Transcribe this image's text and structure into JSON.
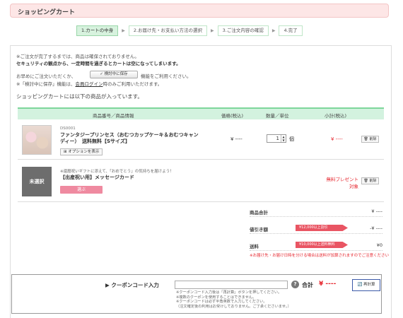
{
  "header": {
    "title": "ショッピングカート"
  },
  "steps": [
    {
      "label": "1.カートの中身",
      "active": true
    },
    {
      "label": "2.お届け先・お支払い方法の選択",
      "active": false
    },
    {
      "label": "3.ご注文内容の確認",
      "active": false
    },
    {
      "label": "4.完了",
      "active": false
    }
  ],
  "notices": {
    "line1": "※ご注文が完了するまでは、商品は確保されておりません。",
    "line2": "セキュリティの観点から、一定時間を過ぎるとカートは空になってしまいます。",
    "save_prefix": "お早めにご注文いただくか、",
    "save_button": "✓ 検討中に保存",
    "save_suffix": "機能をご利用ください。",
    "login_prefix": "※「検討中に保存」機能は、",
    "login_link": "会員ログイン",
    "login_suffix": "時のみご利用いただけます。"
  },
  "cart_intro": "ショッピングカートには以下の商品が入っています。",
  "table": {
    "headers": {
      "product": "商品番号／商品情報",
      "price": "価格(税込)",
      "qty": "数量／単位",
      "subtotal": "小計(税込)"
    }
  },
  "items": [
    {
      "code": "DS0001",
      "name_line1": "ファンタジープリンセス（おむつカップケーキ＆おむつキャン",
      "name_line2": "ディー）　送料無料【Sサイズ】",
      "option_button": "⊞ オプションを表示",
      "price": "¥ ----",
      "qty": "1",
      "unit": "個",
      "subtotal": "¥ ----",
      "delete": "🗑 削除"
    },
    {
      "thumb_label": "未選択",
      "note": "※還暦祝いギフトに添えて、「おめでとう」の気持ちを届けよう！",
      "name": "【出産祝い用】メッセージカード",
      "select_button": "選ぶ",
      "promo_line1": "無料プレゼント",
      "promo_line2": "対象",
      "delete": "🗑 削除"
    }
  ],
  "summary": {
    "subtotal_label": "商品合計",
    "subtotal_value": "¥ ----",
    "discount_label": "値引き額",
    "discount_badge": "¥12,000以上割引",
    "discount_value": "-¥ ----",
    "shipping_label": "送料",
    "shipping_badge": "¥10,000以上送料無料",
    "shipping_value": "¥0",
    "shipping_note": "※お届け先・お届け日時を分ける場合は送料が加算されますのでご注意ください"
  },
  "coupon": {
    "label": "▶ クーポンコード入力",
    "input_value": "",
    "help": "?",
    "total_label": "合計",
    "total_value": "¥ ----",
    "recalc_button": "🔄 再計算",
    "note1": "※クーポンコード入力後は「再計算」ボタンを押してください。",
    "note2": "※複数のクーポンを使用することはできません。",
    "note3": "※クーポンコードは必ず半角英数で入力してください。",
    "note4": "（注文確定後の利用はお受けしておりません。ご了承くださいませ。）"
  },
  "colors": {
    "accent_green": "#7ed69b",
    "header_pink": "#fde6e6",
    "price_red": "#e6262e",
    "badge_red": "#e95563",
    "button_pink": "#ef8aa0"
  }
}
